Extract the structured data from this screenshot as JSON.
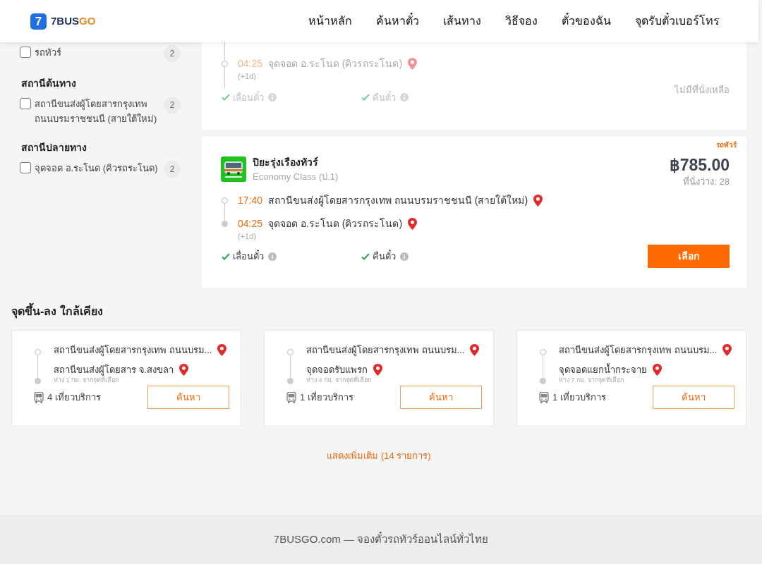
{
  "header": {
    "logo": {
      "mark": "7",
      "name_main": "7BUS",
      "name_accent": "GO"
    },
    "nav": [
      "หน้าหลัก",
      "ค้นหาตั๋ว",
      "เส้นทาง",
      "วิธีจอง",
      "ตั๋วของฉัน",
      "จุดรับตั๋วเบอร์โทร"
    ]
  },
  "filters": [
    {
      "items": [
        {
          "label": "รถทัวร์",
          "count": "2",
          "checked": false
        }
      ]
    },
    {
      "title": "สถานีต้นทาง",
      "items": [
        {
          "label": "สถานีขนส่งผู้โดยสารกรุงเทพ ถนนบรมราชชนนี (สายใต้ใหม่)",
          "count": "2",
          "checked": false
        }
      ]
    },
    {
      "title": "สถานีปลายทาง",
      "items": [
        {
          "label": "จุดจอด อ.ระโนด (คิวรถระโนด)",
          "count": "2",
          "checked": false
        }
      ]
    }
  ],
  "trips": [
    {
      "sold_out": true,
      "stops": [
        {
          "time": "04:25",
          "place": "จุดจอด อ.ระโนด (คิวรถระโนด)",
          "day_offset": "(+1d)"
        }
      ],
      "features": [
        "เลื่อนตั๋ว",
        "คืนตั๋ว"
      ],
      "status": "ไม่มีที่นั่งเหลือ"
    },
    {
      "sold_out": false,
      "tag": "รถทัวร์",
      "operator": "ปิยะรุ่งเรืองทัวร์",
      "class": "Economy Class (ป.1)",
      "price": "฿785.00",
      "seats": "ที่นั่งว่าง: 28",
      "stops": [
        {
          "time": "17:40",
          "place": "สถานีขนส่งผู้โดยสารกรุงเทพ ถนนบรมราชชนนี (สายใต้ใหม่)"
        },
        {
          "time": "04:25",
          "place": "จุดจอด อ.ระโนด (คิวรถระโนด)",
          "day_offset": "(+1d)"
        }
      ],
      "features": [
        "เลื่อนตั๋ว",
        "คืนตั๋ว"
      ],
      "button": "เลือก"
    }
  ],
  "nearby": {
    "title": "จุดขึ้น-ลง ใกล้เคียง",
    "cards": [
      {
        "from": "สถานีขนส่งผู้โดยสารกรุงเทพ ถนนบรม...",
        "to": "สถานีขนส่งผู้โดยสาร จ.สงขลา",
        "distance": "ห่าง 1 กม. จากจุดที่เลือก",
        "trips": "4 เที่ยวบริการ",
        "button": "ค้นหา"
      },
      {
        "from": "สถานีขนส่งผู้โดยสารกรุงเทพ ถนนบรม...",
        "to": "จุดจอดรับแพรก",
        "distance": "ห่าง 4 กม. จากจุดที่เลือก",
        "trips": "1 เที่ยวบริการ",
        "button": "ค้นหา"
      },
      {
        "from": "สถานีขนส่งผู้โดยสารกรุงเทพ ถนนบรม...",
        "to": "จุดจอดแยกน้ำกระจาย",
        "distance": "ห่าง 7 กม. จากจุดที่เลือก",
        "trips": "1 เที่ยวบริการ",
        "button": "ค้นหา"
      }
    ],
    "more": "แสดงเพิ่มเติม (14 รายการ)"
  },
  "footer": "7BUSGO.com — จองตั๋วรถทัวร์ออนไลน์ทั่วไทย"
}
